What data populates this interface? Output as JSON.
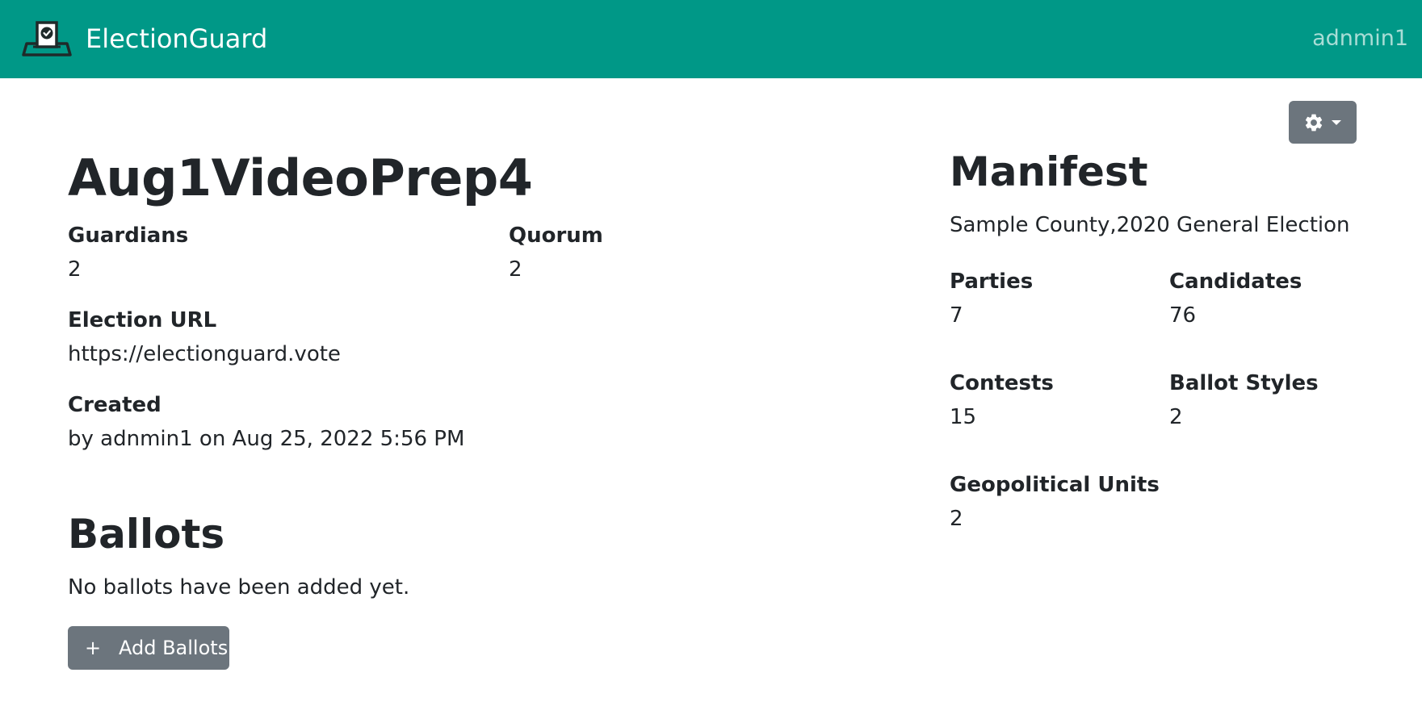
{
  "nav": {
    "brand": "ElectionGuard",
    "user": "adnmin1"
  },
  "toolbar": {
    "settings_icon": "gear-icon",
    "dropdown_icon": "caret-down-icon"
  },
  "election": {
    "title": "Aug1VideoPrep4",
    "guardians_label": "Guardians",
    "guardians_value": "2",
    "quorum_label": "Quorum",
    "quorum_value": "2",
    "url_label": "Election URL",
    "url_value": "https://electionguard.vote",
    "created_label": "Created",
    "created_value": "by adnmin1 on Aug 25, 2022 5:56 PM"
  },
  "ballots": {
    "heading": "Ballots",
    "empty_message": "No ballots have been added yet.",
    "add_icon": "+",
    "add_label": "Add Ballots"
  },
  "manifest": {
    "heading": "Manifest",
    "subtitle": "Sample County,2020 General Election",
    "parties_label": "Parties",
    "parties_value": "7",
    "candidates_label": "Candidates",
    "candidates_value": "76",
    "contests_label": "Contests",
    "contests_value": "15",
    "ballot_styles_label": "Ballot Styles",
    "ballot_styles_value": "2",
    "geo_units_label": "Geopolitical Units",
    "geo_units_value": "2"
  },
  "colors": {
    "navbar": "#009887",
    "button": "#6c757d",
    "text": "#212529"
  }
}
